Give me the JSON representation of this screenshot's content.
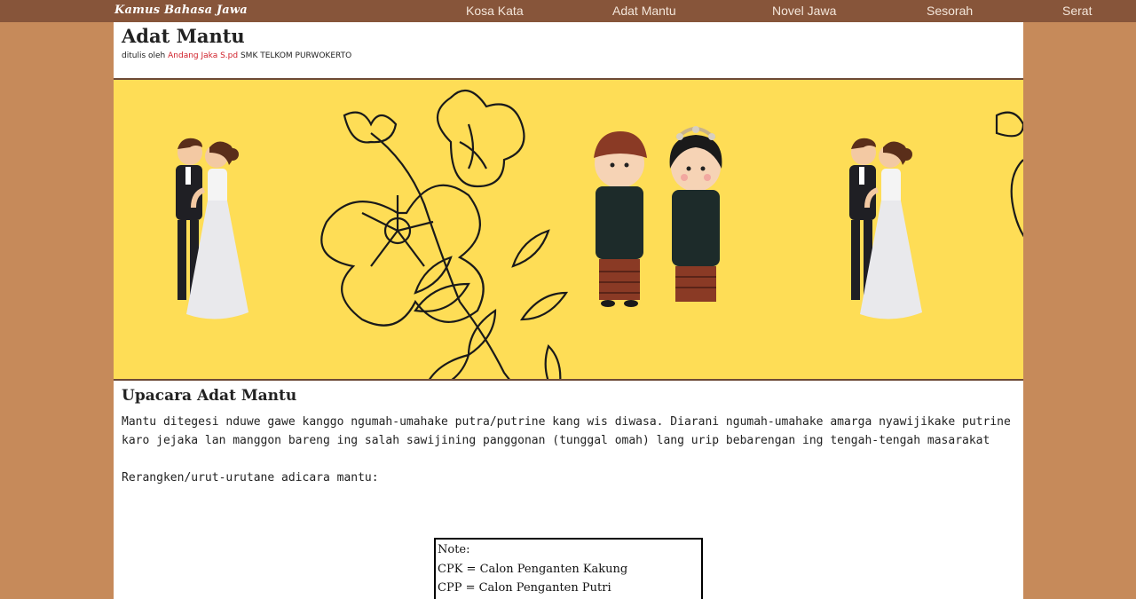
{
  "navbar": {
    "brand": "Kamus Bahasa Jawa",
    "links": [
      "Kosa Kata",
      "Adat Mantu",
      "Novel Jawa",
      "Sesorah",
      "Serat"
    ]
  },
  "header": {
    "title": "Adat Mantu",
    "byline_prefix": "ditulis oleh",
    "author": "Andang Jaka S.pd",
    "school": "SMK TELKOM PURWOKERTO"
  },
  "banner": {
    "background_color": "#fedd56",
    "illustrations": [
      "wedding-couple-icon",
      "flower-line-art-icon",
      "javanese-couple-icon",
      "wedding-couple-icon",
      "flower-line-art-icon"
    ]
  },
  "content": {
    "section_title": "Upacara Adat Mantu",
    "paragraph": "Mantu ditegesi nduwe gawe kanggo ngumah-umahake putra/putrine kang wis diwasa. Diarani ngumah-umahake amarga nyawijikake putrine karo jejaka lan manggon bareng ing salah sawijining panggonan (tunggal omah) lang urip bebarengan ing tengah-tengah masarakat",
    "list_intro": "Rerangken/urut-urutane adicara mantu:"
  },
  "note": {
    "heading": "Note:",
    "lines": [
      "CPK = Calon Penganten Kakung",
      "CPP = Calon Penganten Putri"
    ]
  },
  "colors": {
    "page_background": "#c68a5a",
    "navbar": "#87553a",
    "author_link": "#d0202a"
  }
}
